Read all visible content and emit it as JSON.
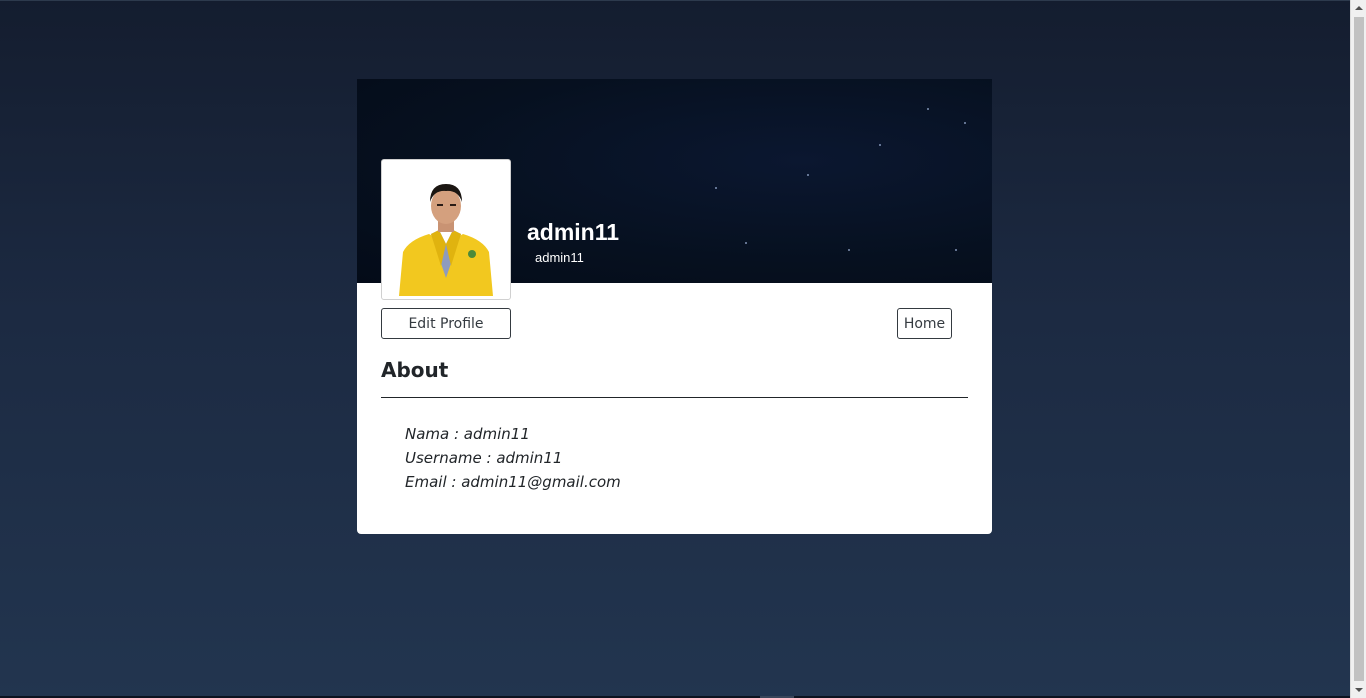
{
  "profile": {
    "display_name": "admin11",
    "username": "admin11"
  },
  "buttons": {
    "edit_profile": "Edit Profile",
    "home": "Home"
  },
  "about": {
    "title": "About",
    "fields": [
      "Nama : admin11",
      "Username : admin11",
      "Email : admin11@gmail.com"
    ]
  },
  "colors": {
    "page_background": "#1c2a42",
    "cover_background": "#06101f",
    "card_background": "#ffffff",
    "jacket_yellow": "#f2c81f"
  },
  "icons": {
    "photo": "profile-photo"
  }
}
